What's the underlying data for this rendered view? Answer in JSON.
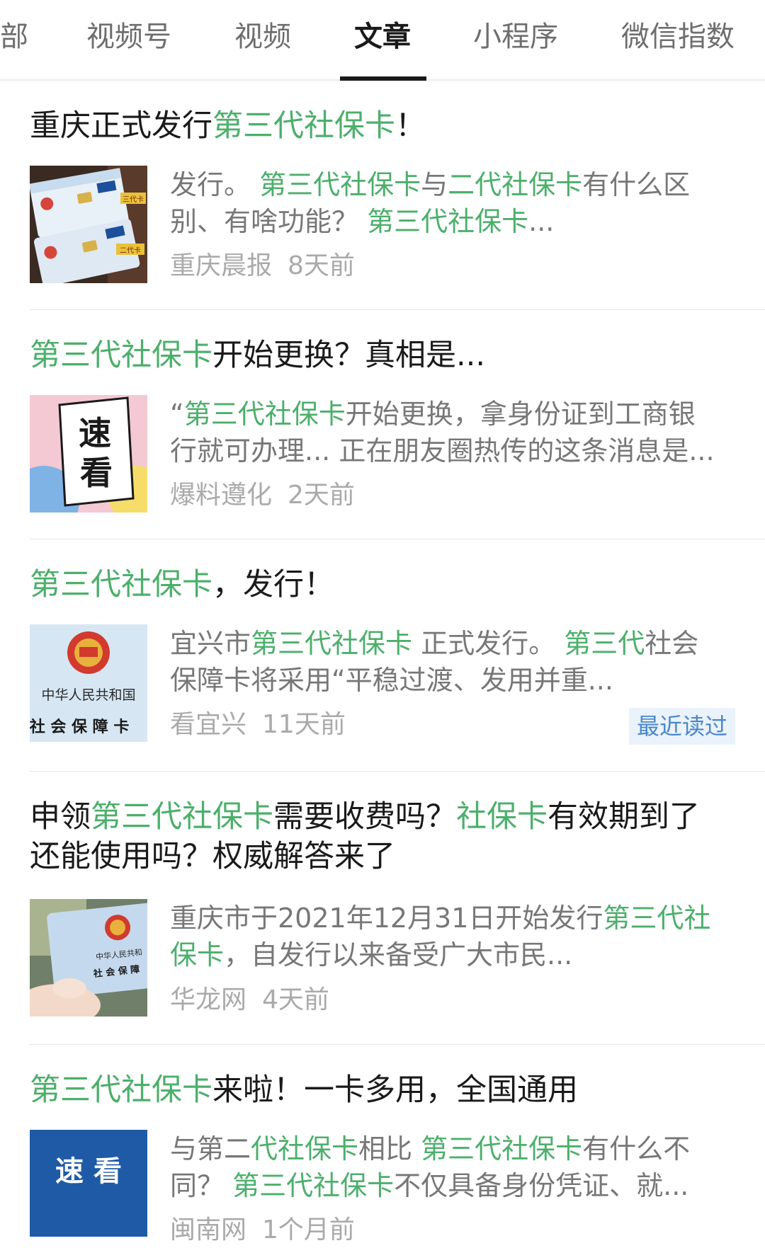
{
  "tabs": [
    {
      "label": "部"
    },
    {
      "label": "视频号"
    },
    {
      "label": "视频"
    },
    {
      "label": "文章",
      "active": true
    },
    {
      "label": "小程序"
    },
    {
      "label": "微信指数"
    }
  ],
  "colors": {
    "highlight": "#4caf6b",
    "title": "#1a1a1a",
    "snippet": "#777777",
    "meta": "#aaaaaa",
    "badge_bg": "#eaf2fb",
    "badge_text": "#4a88c9"
  },
  "articles": [
    {
      "title": [
        {
          "t": "重庆正式发行"
        },
        {
          "t": "第三代社保卡",
          "hl": true
        },
        {
          "t": "！"
        }
      ],
      "snippet_line1": [
        {
          "t": "发行。 "
        },
        {
          "t": "第三代社保卡",
          "hl": true
        },
        {
          "t": "与"
        },
        {
          "t": "二代社保卡",
          "hl": true
        },
        {
          "t": "有什么区"
        }
      ],
      "snippet_line2": [
        {
          "t": "别、有啥功能？ "
        },
        {
          "t": "第三代社保卡",
          "hl": true
        },
        {
          "t": "..."
        }
      ],
      "source": "重庆晨报",
      "time": "8天前",
      "thumb_icon": "social-security-cards-photo",
      "thumb_text": [
        "三代卡",
        "二代卡"
      ]
    },
    {
      "title": [
        {
          "t": "第三代社保卡",
          "hl": true
        },
        {
          "t": "开始更换？真相是..."
        }
      ],
      "snippet_line1": [
        {
          "t": "“"
        },
        {
          "t": "第三代社保卡",
          "hl": true
        },
        {
          "t": "开始更换，拿身份证到工商银"
        }
      ],
      "snippet_line2": [
        {
          "t": "行就可办理... 正在朋友圈热传的这条消息是..."
        }
      ],
      "source": "爆料遵化",
      "time": "2天前",
      "thumb_icon": "sukan-poster",
      "thumb_text": [
        "速",
        "看"
      ]
    },
    {
      "title": [
        {
          "t": "第三代社保卡",
          "hl": true
        },
        {
          "t": "，发行！"
        }
      ],
      "snippet_line1": [
        {
          "t": "宜兴市"
        },
        {
          "t": "第三代社保卡",
          "hl": true
        },
        {
          "t": " 正式发行。 "
        },
        {
          "t": "第三代",
          "hl": true
        },
        {
          "t": "社会"
        }
      ],
      "snippet_line2": [
        {
          "t": "保障卡将采用“平稳过渡、发用并重..."
        }
      ],
      "source": "看宜兴",
      "time": "11天前",
      "badge": "最近读过",
      "thumb_icon": "national-emblem-card",
      "thumb_text": [
        "中华人民共和国",
        "社 会 保 障 卡"
      ]
    },
    {
      "title_line1": [
        {
          "t": "申领"
        },
        {
          "t": "第三代社保卡",
          "hl": true
        },
        {
          "t": "需要收费吗？"
        },
        {
          "t": "社保卡",
          "hl": true
        },
        {
          "t": "有效期到了"
        }
      ],
      "title_line2": [
        {
          "t": "还能使用吗？权威解答来了"
        }
      ],
      "snippet_line1": [
        {
          "t": "重庆市于2021年12月31日开始发行"
        },
        {
          "t": "第三代社",
          "hl": true
        }
      ],
      "snippet_line2": [
        {
          "t": "保卡",
          "hl": true
        },
        {
          "t": "，自发行以来备受广大市民..."
        }
      ],
      "source": "华龙网",
      "time": "4天前",
      "thumb_icon": "hand-holding-card",
      "thumb_text": [
        "中华人民共和",
        "社 会 保 障"
      ]
    },
    {
      "title": [
        {
          "t": "第三代社保卡",
          "hl": true
        },
        {
          "t": "来啦！一卡多用，全国通用"
        }
      ],
      "snippet_line1": [
        {
          "t": "与第二"
        },
        {
          "t": "代社保卡",
          "hl": true
        },
        {
          "t": "相比 "
        },
        {
          "t": "第三代社保卡",
          "hl": true
        },
        {
          "t": "有什么不"
        }
      ],
      "snippet_line2": [
        {
          "t": "同？ "
        },
        {
          "t": "第三代社保卡",
          "hl": true
        },
        {
          "t": "不仅具备身份凭证、就..."
        }
      ],
      "source": "闽南网",
      "time": "1个月前",
      "thumb_icon": "sukan-banner",
      "thumb_text": [
        "速 看"
      ]
    }
  ]
}
